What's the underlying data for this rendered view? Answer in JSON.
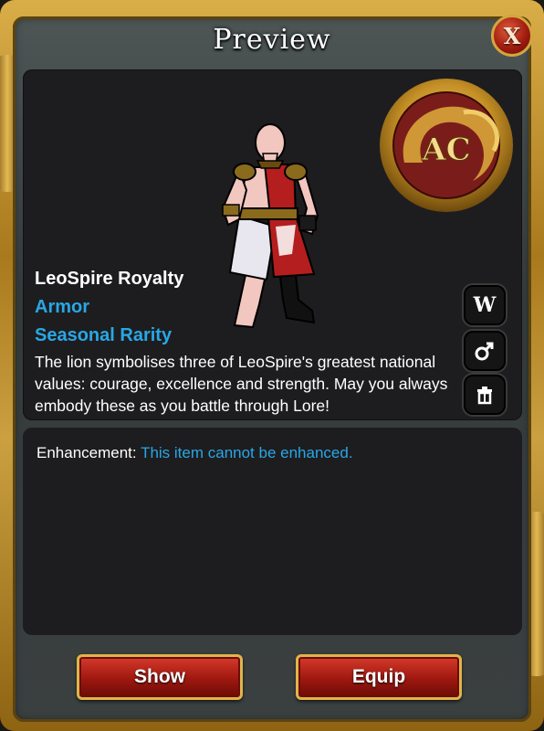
{
  "window": {
    "title": "Preview",
    "close_label": "X"
  },
  "item": {
    "name": "LeoSpire Royalty",
    "type": "Armor",
    "rarity": "Seasonal Rarity",
    "description": "The lion symbolises three of LeoSpire's greatest national values: courage, excellence and strength. May you always embody these as you battle through Lore!"
  },
  "emblem": {
    "text": "AC"
  },
  "side_buttons": {
    "wear_label": "W",
    "gender_icon": "male-icon",
    "delete_icon": "trash-icon"
  },
  "enhancement": {
    "label": "Enhancement:",
    "value": "This item cannot be enhanced."
  },
  "actions": {
    "show_label": "Show",
    "equip_label": "Equip"
  },
  "colors": {
    "accent_blue": "#29a7e6",
    "frame_gold": "#c89a35",
    "button_red": "#a3190f",
    "panel_bg": "#1d1d1f"
  }
}
